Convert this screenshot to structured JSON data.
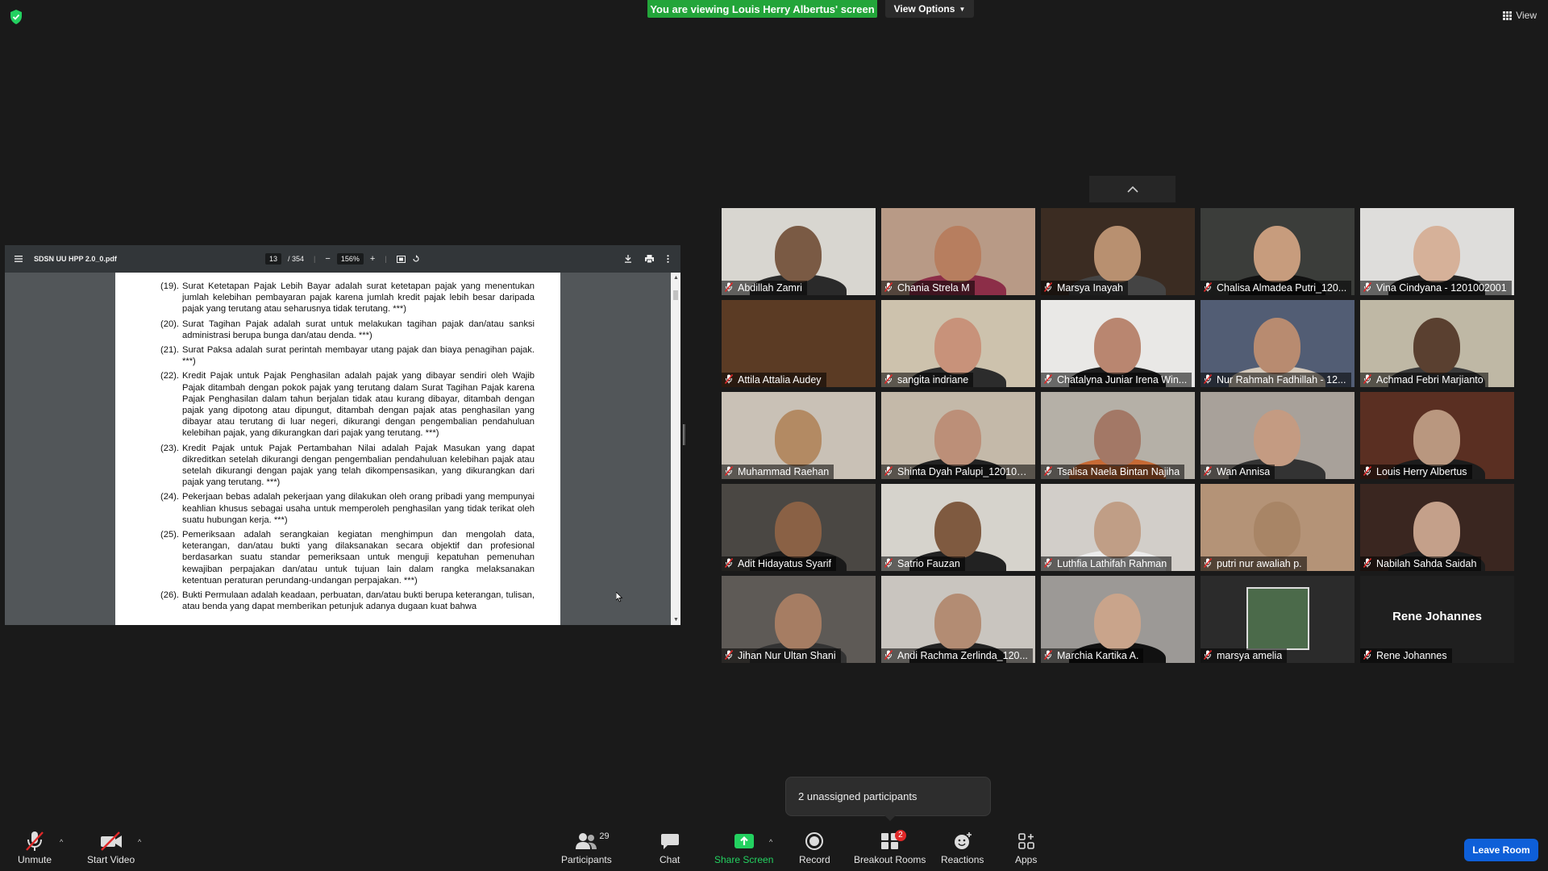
{
  "top": {
    "banner": "You are viewing Louis Herry Albertus' screen",
    "view_options": "View Options",
    "view_label": "View"
  },
  "pdf": {
    "filename": "SDSN UU HPP 2.0_0.pdf",
    "page": "13",
    "page_total": "/ 354",
    "zoom": "156%",
    "items": [
      {
        "num": "(19).",
        "text": "Surat Ketetapan Pajak Lebih Bayar adalah surat ketetapan pajak yang menentukan jumlah kelebihan pembayaran pajak karena jumlah kredit pajak lebih besar daripada pajak yang terutang atau seharusnya tidak terutang. ***)"
      },
      {
        "num": "(20).",
        "text": "Surat Tagihan Pajak adalah surat untuk melakukan tagihan pajak dan/atau sanksi administrasi berupa bunga dan/atau denda. ***)"
      },
      {
        "num": "(21).",
        "text": "Surat Paksa adalah surat perintah membayar utang pajak dan biaya penagihan pajak. ***)"
      },
      {
        "num": "(22).",
        "text": "Kredit Pajak untuk Pajak Penghasilan adalah pajak yang dibayar sendiri oleh Wajib Pajak ditambah dengan pokok pajak yang terutang dalam Surat Tagihan Pajak karena Pajak Penghasilan dalam tahun berjalan tidak atau kurang dibayar, ditambah dengan pajak yang dipotong atau dipungut, ditambah dengan pajak atas penghasilan yang dibayar atau terutang di luar negeri, dikurangi dengan pengembalian pendahuluan kelebihan pajak, yang dikurangkan dari pajak yang terutang. ***)"
      },
      {
        "num": "(23).",
        "text": "Kredit Pajak untuk Pajak Pertambahan Nilai adalah Pajak Masukan yang dapat dikreditkan setelah dikurangi dengan pengembalian pendahuluan kelebihan pajak atau setelah dikurangi dengan pajak yang telah dikompensasikan, yang dikurangkan dari pajak yang terutang. ***)"
      },
      {
        "num": "(24).",
        "text": "Pekerjaan bebas adalah pekerjaan yang dilakukan oleh orang pribadi yang mempunyai keahlian khusus sebagai usaha untuk memperoleh penghasilan yang tidak terikat oleh suatu hubungan kerja. ***)"
      },
      {
        "num": "(25).",
        "text": "Pemeriksaan adalah serangkaian kegiatan menghimpun dan mengolah data, keterangan, dan/atau bukti yang dilaksanakan secara objektif dan profesional berdasarkan suatu standar pemeriksaan untuk menguji kepatuhan pemenuhan kewajiban perpajakan dan/atau untuk tujuan lain dalam rangka melaksanakan ketentuan peraturan perundang-undangan perpajakan. ***)"
      },
      {
        "num": "(26).",
        "text": "Bukti Permulaan adalah keadaan, perbuatan, dan/atau bukti berupa keterangan, tulisan, atau benda yang dapat memberikan petunjuk adanya dugaan kuat bahwa"
      }
    ]
  },
  "participants": [
    {
      "name": "Abdillah Zamri",
      "bg": "#d8d6d0",
      "skin": "#7a5a44",
      "shirt": "#2a2a2a"
    },
    {
      "name": "Chania Strela M",
      "bg": "#b89a86",
      "skin": "#b77e5f",
      "shirt": "#8c2e48"
    },
    {
      "name": "Marsya Inayah",
      "bg": "#3b2c22",
      "skin": "#b89070",
      "shirt": "#444"
    },
    {
      "name": "Chalisa Almadea Putri_120...",
      "bg": "#3b3d3a",
      "skin": "#c79c7d",
      "shirt": "#111"
    },
    {
      "name": "Vina Cindyana - 1201002001",
      "bg": "#dedddb",
      "skin": "#d6b199",
      "shirt": "#222"
    },
    {
      "name": "Attila Attalia Audey",
      "bg": "#5b3b24",
      "skin": "#5b3b24",
      "shirt": "#5b3b24"
    },
    {
      "name": "sangita indriane",
      "bg": "#cdc2ad",
      "skin": "#c8927a",
      "shirt": "#2c2c2c"
    },
    {
      "name": "Chatalyna Juniar Irena Win...",
      "bg": "#e9e8e6",
      "skin": "#b98670",
      "shirt": "#1d1d1d"
    },
    {
      "name": "Nur Rahmah Fadhillah - 12...",
      "bg": "#525d74",
      "skin": "#b88b70",
      "shirt": "#d4c9bb"
    },
    {
      "name": "Achmad Febri Marjianto",
      "bg": "#bfb8a5",
      "skin": "#5a4030",
      "shirt": "#3a3a3a"
    },
    {
      "name": "Muhammad Raehan",
      "bg": "#c9c1b6",
      "skin": "#b38a63",
      "shirt": "#c9c1b6"
    },
    {
      "name": "Shinta Dyah Palupi_120100...",
      "bg": "#c4b9a9",
      "skin": "#bc8f78",
      "shirt": "#222"
    },
    {
      "name": "Tsalisa Naela Bintan Najiha",
      "bg": "#b5b0a7",
      "skin": "#a37866",
      "shirt": "#c76a35"
    },
    {
      "name": "Wan Annisa",
      "bg": "#a8a19a",
      "skin": "#c49b82",
      "shirt": "#333"
    },
    {
      "name": "Louis Herry Albertus",
      "bg": "#5a2f22",
      "skin": "#b9977f",
      "shirt": "#1c1c1c"
    },
    {
      "name": "Adit Hidayatus Syarif",
      "bg": "#4a4743",
      "skin": "#8a6145",
      "shirt": "#1a1a1a"
    },
    {
      "name": "Satrio Fauzan",
      "bg": "#d6d3cc",
      "skin": "#7f5a40",
      "shirt": "#222"
    },
    {
      "name": "Luthfia Lathifah Rahman",
      "bg": "#d2cec9",
      "skin": "#c09e86",
      "shirt": "#ececec"
    },
    {
      "name": "putri nur awaliah p.",
      "bg": "#b49377",
      "skin": "#a88566",
      "shirt": "#b49377"
    },
    {
      "name": "Nabilah Sahda Saidah",
      "bg": "#3a2620",
      "skin": "#c4a08a",
      "shirt": "#1c1c1c"
    },
    {
      "name": "Jihan Nur Ultan Shani",
      "bg": "#5e5a56",
      "skin": "#a67d63",
      "shirt": "#333"
    },
    {
      "name": "Andi Rachma Zerlinda_120...",
      "bg": "#c9c5bf",
      "skin": "#b38c73",
      "shirt": "#222"
    },
    {
      "name": "Marchia Kartika A.",
      "bg": "#9c9996",
      "skin": "#c9a48b",
      "shirt": "#111"
    },
    {
      "name": "marsya amelia",
      "bg": "#1f1f1f",
      "skin": "",
      "shirt": "",
      "photo": true
    },
    {
      "name": "Rene Johannes",
      "bg": "#1f1f1f",
      "skin": "",
      "shirt": "",
      "nocam": true
    }
  ],
  "popover": "2 unassigned participants",
  "toolbar": {
    "unmute": "Unmute",
    "start_video": "Start Video",
    "participants": "Participants",
    "participants_count": "29",
    "chat": "Chat",
    "share_screen": "Share Screen",
    "record": "Record",
    "breakout": "Breakout Rooms",
    "breakout_badge": "2",
    "reactions": "Reactions",
    "apps": "Apps",
    "leave": "Leave Room"
  },
  "colors": {
    "banner": "#23a53a",
    "share_green": "#23d160",
    "leave_blue": "#0e5fd8",
    "mute_red": "#e02828"
  }
}
